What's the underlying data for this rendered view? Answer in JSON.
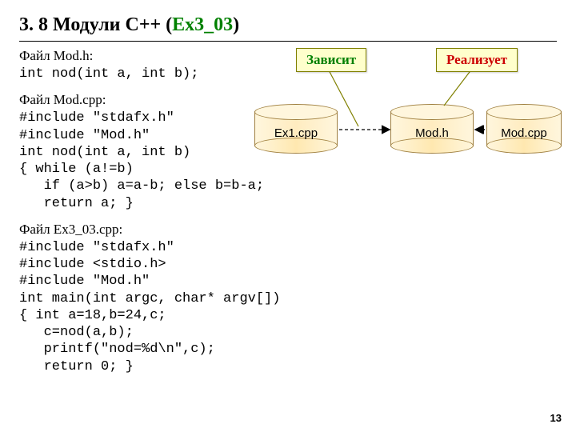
{
  "title_prefix": "3. 8 Модули С++ (",
  "title_ex": "Ex3_03",
  "title_suffix": ")",
  "modh_label": "Файл Mod.h:",
  "modh_code": "int nod(int a, int b);",
  "modcpp_label": "Файл Mod.cpp:",
  "modcpp_code": "#include \"stdafx.h\"\n#include \"Mod.h\"\nint nod(int a, int b)\n{ while (a!=b)\n   if (a>b) a=a-b; else b=b-a;\n   return a; }",
  "ex_label": "Файл Ex3_03.cpp:",
  "ex_code": "#include \"stdafx.h\"\n#include <stdio.h>\n#include \"Mod.h\"\nint main(int argc, char* argv[])\n{ int a=18,b=24,c;\n   c=nod(a,b);\n   printf(\"nod=%d\\n\",c);\n   return 0; }",
  "callout_depends": "Зависит",
  "callout_implements": "Реализует",
  "cyl_ex": "Ex1.cpp",
  "cyl_modh": "Mod.h",
  "cyl_modcpp": "Mod.cpp",
  "page": "13"
}
